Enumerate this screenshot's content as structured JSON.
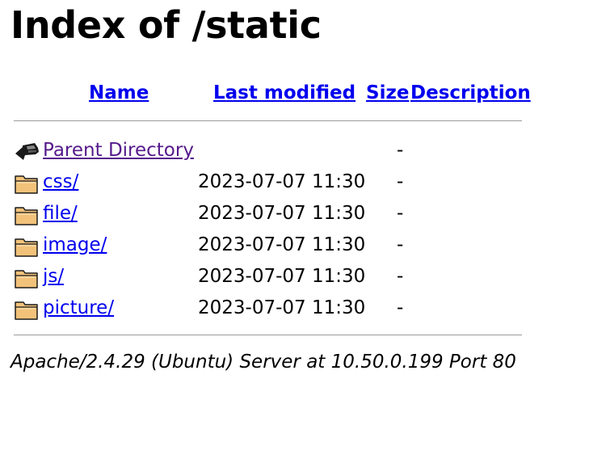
{
  "page": {
    "title": "Index of /static"
  },
  "table": {
    "headers": {
      "name": "Name",
      "last_modified": "Last modified",
      "size": "Size",
      "description": "Description"
    },
    "parent": {
      "icon": "back-arrow-icon",
      "label": "Parent Directory",
      "size": "-"
    },
    "rows": [
      {
        "icon": "folder-icon",
        "name": "css/",
        "modified": "2023-07-07 11:30",
        "size": "-"
      },
      {
        "icon": "folder-icon",
        "name": "file/",
        "modified": "2023-07-07 11:30",
        "size": "-"
      },
      {
        "icon": "folder-icon",
        "name": "image/",
        "modified": "2023-07-07 11:30",
        "size": "-"
      },
      {
        "icon": "folder-icon",
        "name": "js/",
        "modified": "2023-07-07 11:30",
        "size": "-"
      },
      {
        "icon": "folder-icon",
        "name": "picture/",
        "modified": "2023-07-07 11:30",
        "size": "-"
      }
    ]
  },
  "footer": {
    "address": "Apache/2.4.29 (Ubuntu) Server at 10.50.0.199 Port 80"
  },
  "colors": {
    "link": "#0000ee",
    "visited_link": "#551a8b",
    "rule": "#9a9a9a",
    "folder": "#f2c27a"
  }
}
